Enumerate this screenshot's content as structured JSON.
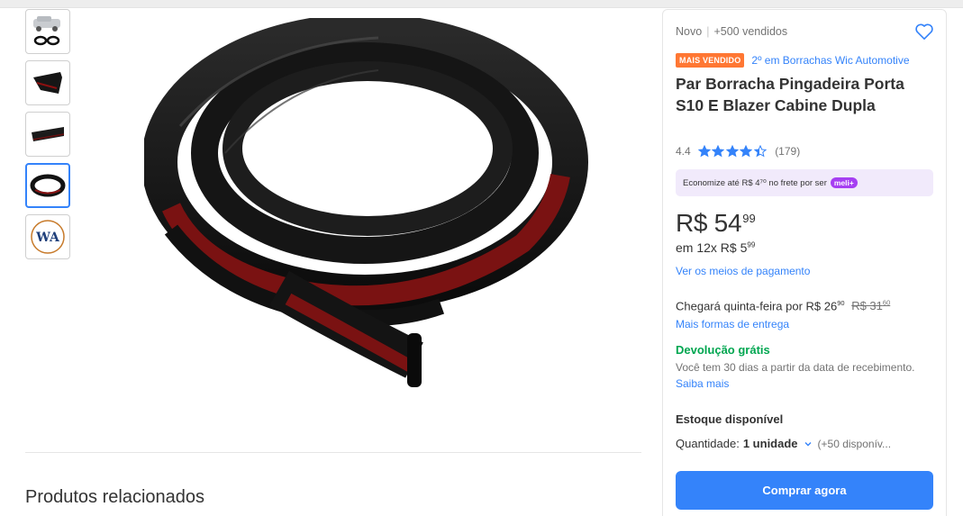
{
  "gallery": {
    "thumbnails": [
      {
        "name": "thumb-truck-kit"
      },
      {
        "name": "thumb-profile-cross-section"
      },
      {
        "name": "thumb-strip-side"
      },
      {
        "name": "thumb-coil"
      },
      {
        "name": "thumb-logo"
      }
    ],
    "logo_text": "WA"
  },
  "related": {
    "title": "Produtos relacionados"
  },
  "product": {
    "condition": "Novo",
    "sold": "+500 vendidos",
    "badge": "MAIS VENDIDO",
    "rank": "2º em Borrachas Wic Automotive",
    "title": "Par Borracha Pingadeira Porta S10 E Blazer Cabine Dupla",
    "rating": "4.4",
    "rating_value": 4.4,
    "reviews": "(179)",
    "meli_text": "Economize até R$ 4⁷⁰ no frete por ser",
    "meli_pill": "meli+",
    "price": "R$ 54",
    "price_cents": "99",
    "installments": "em 12x R$ 5",
    "installments_cents": "99",
    "payment_link": "Ver os meios de pagamento",
    "shipping": "Chegará quinta-feira por R$ 26",
    "shipping_cents": "90",
    "shipping_old": "R$ 31",
    "shipping_old_cents": "60",
    "delivery_link": "Mais formas de entrega",
    "returns_title": "Devolução grátis",
    "returns_text": "Você tem 30 dias a partir da data de recebimento.",
    "returns_link": "Saiba mais",
    "stock": "Estoque disponível",
    "quantity_label": "Quantidade:",
    "quantity_value": "1 unidade",
    "quantity_available": "(+50 disponív...",
    "buy_button": "Comprar agora"
  },
  "colors": {
    "accent": "#3483fa",
    "badge": "#ff7733",
    "success": "#00a650",
    "meli": "#a63ff2"
  }
}
